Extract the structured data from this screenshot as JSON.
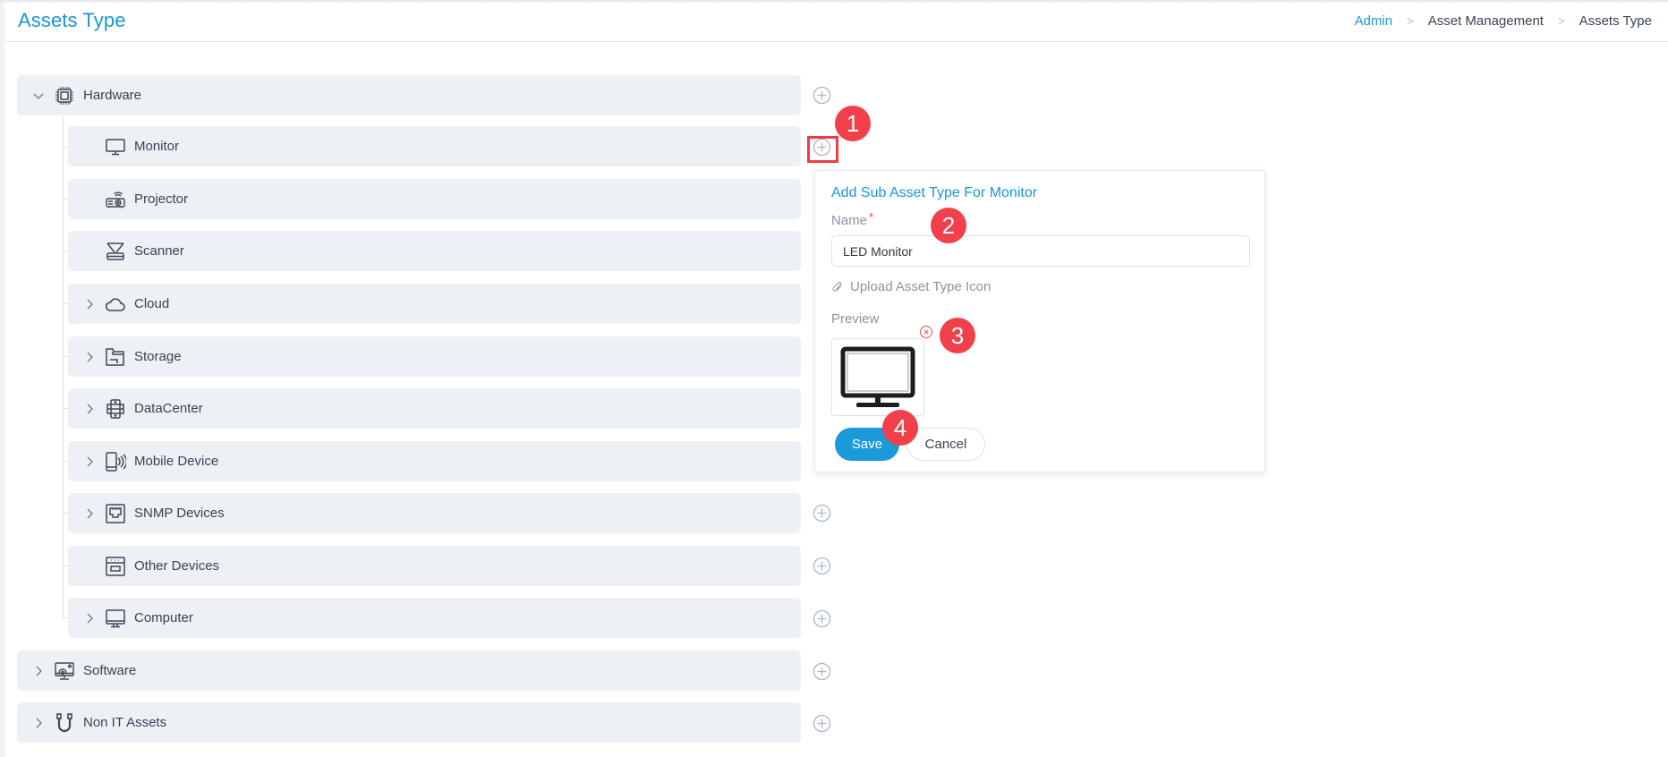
{
  "header": {
    "title": "Assets Type",
    "breadcrumb": [
      {
        "label": "Admin",
        "link": true
      },
      {
        "label": "Asset Management",
        "link": false
      },
      {
        "label": "Assets Type",
        "link": false
      }
    ]
  },
  "tree": {
    "root": [
      {
        "label": "Hardware",
        "icon": "chip-icon",
        "expanded": true,
        "has_children": true
      },
      {
        "label": "Software",
        "icon": "software-monitor-icon",
        "expanded": false,
        "has_children": true
      },
      {
        "label": "Non IT Assets",
        "icon": "cable-icon",
        "expanded": false,
        "has_children": true
      }
    ],
    "hardware_children": [
      {
        "label": "Monitor",
        "icon": "monitor-icon",
        "has_children": false
      },
      {
        "label": "Projector",
        "icon": "projector-icon",
        "has_children": false
      },
      {
        "label": "Scanner",
        "icon": "scanner-icon",
        "has_children": false
      },
      {
        "label": "Cloud",
        "icon": "cloud-icon",
        "has_children": true
      },
      {
        "label": "Storage",
        "icon": "storage-icon",
        "has_children": true
      },
      {
        "label": "DataCenter",
        "icon": "datacenter-icon",
        "has_children": true
      },
      {
        "label": "Mobile Device",
        "icon": "mobile-device-icon",
        "has_children": true
      },
      {
        "label": "SNMP Devices",
        "icon": "snmp-icon",
        "has_children": true
      },
      {
        "label": "Other Devices",
        "icon": "other-devices-icon",
        "has_children": false
      },
      {
        "label": "Computer",
        "icon": "computer-icon",
        "has_children": true
      }
    ]
  },
  "popup": {
    "title": "Add Sub Asset Type For Monitor",
    "name_label": "Name",
    "required_mark": "*",
    "name_value": "LED Monitor",
    "upload_label": "Upload Asset Type Icon",
    "preview_label": "Preview",
    "preview_icon": "monitor-icon",
    "save_label": "Save",
    "cancel_label": "Cancel"
  },
  "annotations": {
    "steps": [
      "1",
      "2",
      "3",
      "4"
    ],
    "highlight_color": "#ef3b45"
  },
  "colors": {
    "accent": "#1a96d6",
    "row_bg": "#edf0f5",
    "step_badge": "#f2404a"
  }
}
